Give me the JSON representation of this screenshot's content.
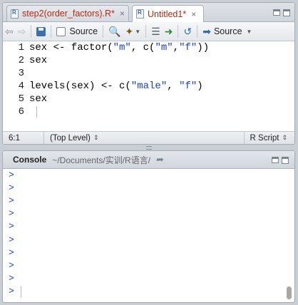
{
  "editor": {
    "tabs": [
      {
        "label": "step2(order_factors).R*",
        "close": "×",
        "active": false
      },
      {
        "label": "Untitled1*",
        "close": "×",
        "active": true
      }
    ],
    "toolbar": {
      "source_on_save_label": "Source",
      "source_button_label": "Source"
    },
    "lines": [
      {
        "num": "1",
        "segments": [
          {
            "t": "sex <- factor(",
            "s": ""
          },
          {
            "t": "\"m\"",
            "s": "str"
          },
          {
            "t": ", c(",
            "s": ""
          },
          {
            "t": "\"m\"",
            "s": "str"
          },
          {
            "t": ",",
            "s": ""
          },
          {
            "t": "\"f\"",
            "s": "str"
          },
          {
            "t": "))",
            "s": ""
          }
        ]
      },
      {
        "num": "2",
        "segments": [
          {
            "t": "sex",
            "s": ""
          }
        ]
      },
      {
        "num": "3",
        "segments": []
      },
      {
        "num": "4",
        "segments": [
          {
            "t": "levels(sex) <- c(",
            "s": ""
          },
          {
            "t": "\"male\"",
            "s": "str"
          },
          {
            "t": ", ",
            "s": ""
          },
          {
            "t": "\"f\"",
            "s": "str"
          },
          {
            "t": ")",
            "s": ""
          }
        ]
      },
      {
        "num": "5",
        "segments": [
          {
            "t": "sex",
            "s": ""
          }
        ]
      },
      {
        "num": "6",
        "segments": []
      }
    ],
    "status": {
      "position": "6:1",
      "scope": "(Top Level)",
      "file_type": "R Script"
    }
  },
  "console": {
    "title": "Console",
    "path": "~/Documents/实训/R语言/",
    "prompts": [
      ">",
      ">",
      ">",
      ">",
      ">",
      ">",
      ">",
      ">",
      ">",
      ">"
    ]
  },
  "colors": {
    "tab_text": "#b42a14",
    "string": "#1b3fd8",
    "prompt": "#1b3fd8"
  }
}
